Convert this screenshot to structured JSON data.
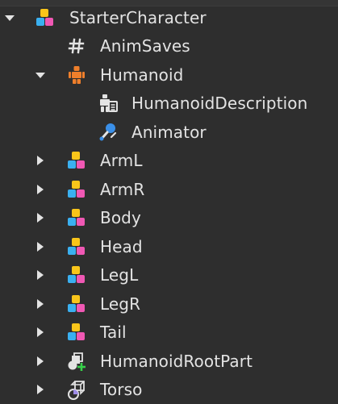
{
  "explorer": {
    "items": [
      {
        "label": "StarterCharacter",
        "icon": "model-icon",
        "level": 0,
        "expanded": true
      },
      {
        "label": "AnimSaves",
        "icon": "hash-icon",
        "level": 1
      },
      {
        "label": "Humanoid",
        "icon": "humanoid-icon",
        "level": 1,
        "expanded": true
      },
      {
        "label": "HumanoidDescription",
        "icon": "humanoid-description-icon",
        "level": 2
      },
      {
        "label": "Animator",
        "icon": "animator-icon",
        "level": 2
      },
      {
        "label": "ArmL",
        "icon": "model-icon",
        "level": 1,
        "expanded": false
      },
      {
        "label": "ArmR",
        "icon": "model-icon",
        "level": 1,
        "expanded": false
      },
      {
        "label": "Body",
        "icon": "model-icon",
        "level": 1,
        "expanded": false
      },
      {
        "label": "Head",
        "icon": "model-icon",
        "level": 1,
        "expanded": false
      },
      {
        "label": "LegL",
        "icon": "model-icon",
        "level": 1,
        "expanded": false
      },
      {
        "label": "LegR",
        "icon": "model-icon",
        "level": 1,
        "expanded": false
      },
      {
        "label": "Tail",
        "icon": "model-icon",
        "level": 1,
        "expanded": false
      },
      {
        "label": "HumanoidRootPart",
        "icon": "part-icon",
        "level": 1,
        "expanded": false
      },
      {
        "label": "Torso",
        "icon": "meshpart-icon",
        "level": 1,
        "expanded": false
      }
    ]
  },
  "colors": {
    "background": "#2e2e2e",
    "text": "#e3e3e3",
    "model_yellow": "#f9c51a",
    "model_blue": "#3ab0f0",
    "model_pink": "#f058b4",
    "humanoid_orange": "#ef7f2b",
    "animator_blue": "#3a8fe8",
    "green_plus": "#37d14a",
    "purple": "#9d8ae6"
  }
}
